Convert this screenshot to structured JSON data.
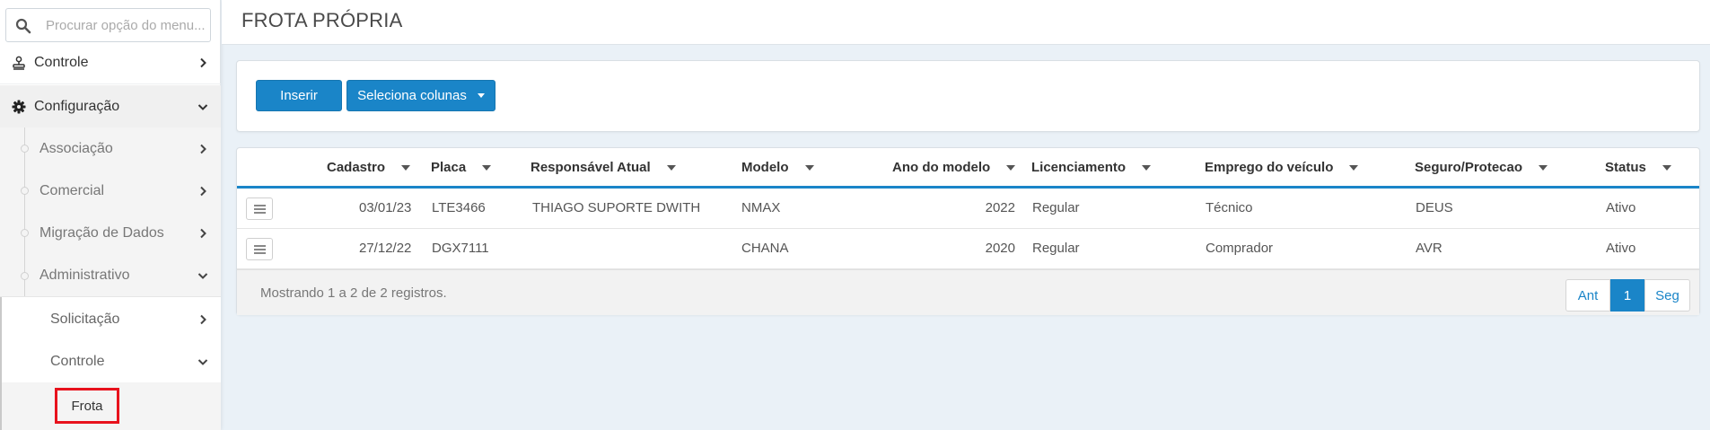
{
  "sidebar": {
    "search_placeholder": "Procurar opção do menu...",
    "items": [
      {
        "label": "Controle",
        "icon": "stamp-icon"
      },
      {
        "label": "Configuração",
        "icon": "gear-icon"
      }
    ],
    "sub_items": [
      {
        "label": "Associação"
      },
      {
        "label": "Comercial"
      },
      {
        "label": "Migração de Dados"
      },
      {
        "label": "Administrativo"
      }
    ],
    "sub2_items": [
      {
        "label": "Solicitação"
      },
      {
        "label": "Controle"
      }
    ],
    "active_item": {
      "label": "Frota"
    }
  },
  "header": {
    "title": "FROTA PRÓPRIA"
  },
  "toolbar": {
    "insert_label": "Inserir",
    "columns_label": "Seleciona colunas"
  },
  "table": {
    "columns": [
      "Cadastro",
      "Placa",
      "Responsável Atual",
      "Modelo",
      "Ano do modelo",
      "Licenciamento",
      "Emprego do veículo",
      "Seguro/Protecao",
      "Status"
    ],
    "rows": [
      {
        "cadastro": "03/01/23",
        "placa": "LTE3466",
        "responsavel": "THIAGO SUPORTE DWITH",
        "modelo": "NMAX",
        "ano": "2022",
        "licenciamento": "Regular",
        "emprego": "Técnico",
        "seguro": "DEUS",
        "status": "Ativo"
      },
      {
        "cadastro": "27/12/22",
        "placa": "DGX7111",
        "responsavel": "",
        "modelo": "CHANA",
        "ano": "2020",
        "licenciamento": "Regular",
        "emprego": "Comprador",
        "seguro": "AVR",
        "status": "Ativo"
      }
    ],
    "records_text": "Mostrando 1 a 2 de 2 registros.",
    "pager": {
      "prev": "Ant",
      "current": "1",
      "next": "Seg"
    }
  },
  "colors": {
    "accent": "#1a85c8",
    "highlight": "#e8121d"
  }
}
